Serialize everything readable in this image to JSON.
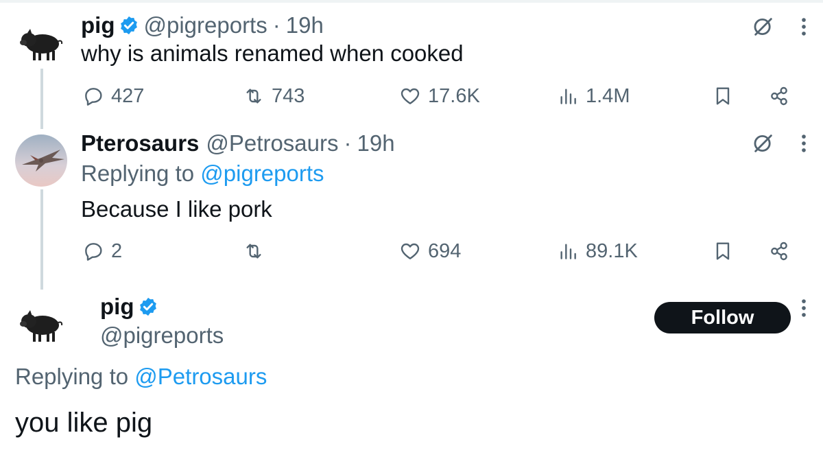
{
  "tweets": [
    {
      "author_name": "pig",
      "handle": "@pigreports",
      "separator": "·",
      "time": "19h",
      "text": "why is animals renamed when cooked",
      "replies": "427",
      "reposts": "743",
      "likes": "17.6K",
      "views": "1.4M"
    },
    {
      "author_name": "Pterosaurs",
      "handle": "@Petrosaurs",
      "separator": "·",
      "time": "19h",
      "replying_prefix": "Replying to",
      "replying_to": "@pigreports",
      "text": "Because I like pork",
      "replies": "2",
      "reposts": "",
      "likes": "694",
      "views": "89.1K"
    }
  ],
  "focused_tweet": {
    "author_name": "pig",
    "handle": "@pigreports",
    "follow_label": "Follow",
    "replying_prefix": "Replying to",
    "replying_to": "@Petrosaurs",
    "text": "you like pig"
  },
  "colors": {
    "accent": "#1d9bf0",
    "secondary_text": "#536471",
    "follow_button": "#0f1419"
  },
  "icons": [
    "verified-icon",
    "grok-icon",
    "more-icon",
    "reply-icon",
    "repost-icon",
    "like-icon",
    "views-icon",
    "bookmark-icon",
    "share-icon"
  ]
}
